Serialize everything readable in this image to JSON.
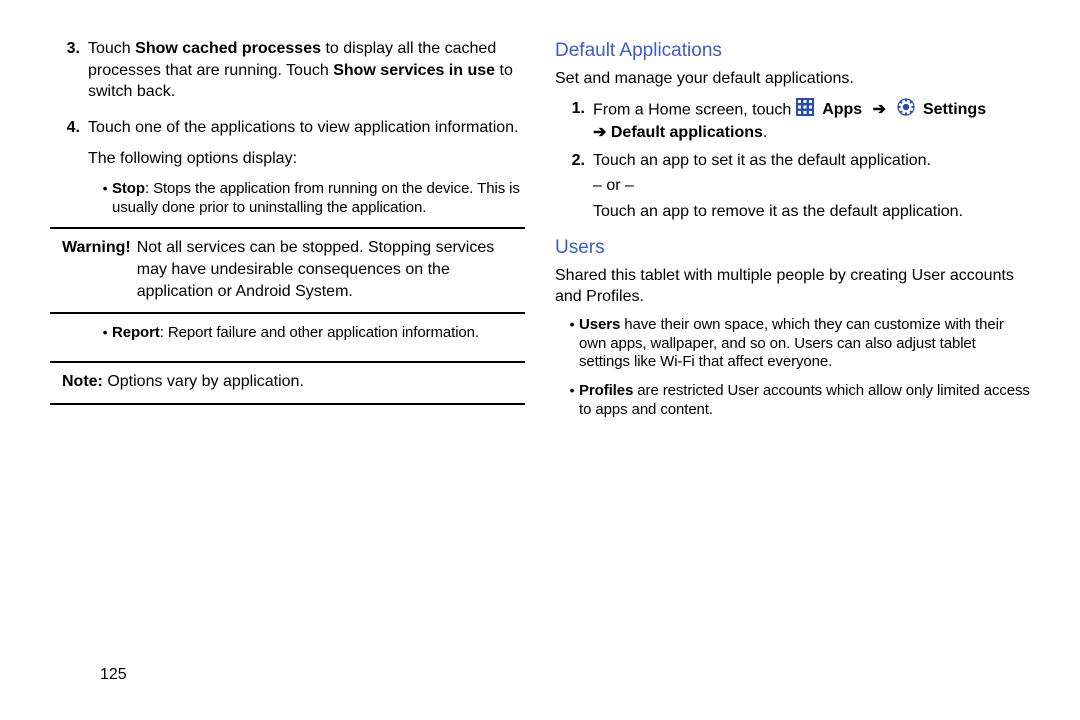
{
  "left": {
    "item3_prefix": "3.",
    "item3_a": "Touch ",
    "item3_b1": "Show cached processes",
    "item3_c": " to display all the cached processes that are running. Touch ",
    "item3_b2": "Show services in use",
    "item3_d": " to switch back.",
    "item4_prefix": "4.",
    "item4_a": "Touch one of the applications to view application information.",
    "options_intro": "The following options display:",
    "stop_label": "Stop",
    "stop_text": ": Stops the application from running on the device. This is usually done prior to uninstalling the application.",
    "warn_label": "Warning!",
    "warn_text": " Not all services can be stopped. Stopping services may have undesirable consequences on the application or Android System.",
    "report_label": "Report",
    "report_text": ": Report failure and other application information.",
    "note_label": "Note:",
    "note_text": " Options vary by application."
  },
  "right": {
    "h1": "Default Applications",
    "intro1": "Set and manage your default applications.",
    "s1_prefix": "1.",
    "s1_a": "From a Home screen, touch ",
    "s1_apps": "Apps",
    "s1_settings": "Settings",
    "s1_arrow2": "➔ ",
    "s1_default": "Default applications",
    "s1_period": ".",
    "s2_prefix": "2.",
    "s2_text": "Touch an app to set it as the default application.",
    "or": "– or –",
    "s2_text2": "Touch an app to remove it as the default application.",
    "h2": "Users",
    "intro2": "Shared this tablet with multiple people by creating User accounts and Profiles.",
    "u_b1_label": "Users",
    "u_b1_text": " have their own space, which they can customize with their own apps, wallpaper, and so on. Users can also adjust tablet settings like Wi-Fi that affect everyone.",
    "u_b2_label": "Profiles",
    "u_b2_text": " are restricted User accounts which allow only limited access to apps and content."
  },
  "footer_page": "125"
}
